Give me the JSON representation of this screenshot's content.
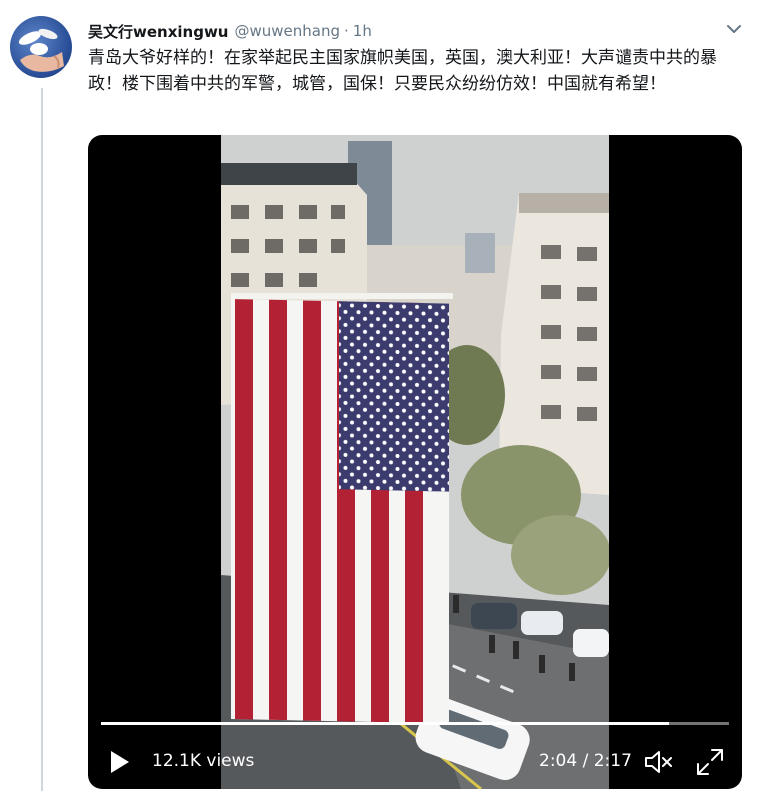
{
  "tweet": {
    "display_name": "吴文行wenxingwu",
    "handle": "@wuwenhang",
    "separator": "·",
    "time": "1h",
    "text": "青岛大爷好样的！在家举起民主国家旗帜美国，英国，澳大利亚！大声谴责中共的暴政！楼下围着中共的军警，城管，国保！只要民众纷纷仿效！中国就有希望！",
    "avatar_icon": "doves-avatar-icon",
    "caret_icon": "chevron-down-icon"
  },
  "video": {
    "views": "12.1K views",
    "current_time": "2:04",
    "duration": "2:17",
    "progress_fraction": 0.905,
    "play_icon": "play-icon",
    "mute_icon": "muted-speaker-icon",
    "fullscreen_icon": "fullscreen-icon"
  },
  "colors": {
    "accent": "#1da1f2",
    "text": "#14171a",
    "secondary": "#657786",
    "thread_line": "#ccd6dd",
    "flag_red": "#b22234",
    "flag_blue": "#3c3b6e"
  }
}
